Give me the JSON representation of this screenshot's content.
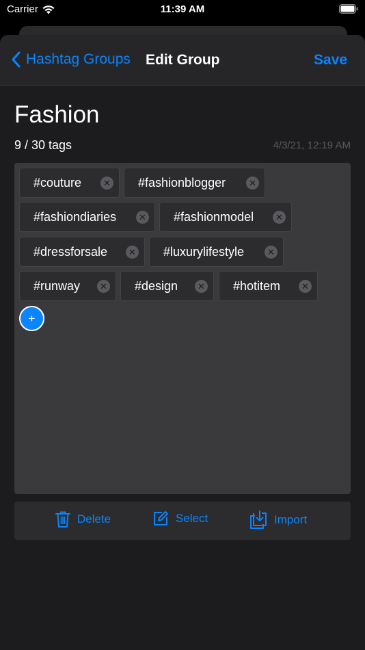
{
  "status": {
    "carrier": "Carrier",
    "time": "11:39 AM"
  },
  "nav": {
    "back_label": "Hashtag Groups",
    "title": "Edit Group",
    "save_label": "Save"
  },
  "group": {
    "name": "Fashion",
    "count_text": "9 / 30 tags",
    "timestamp": "4/3/21, 12:19 AM"
  },
  "tags": [
    "#couture",
    "#fashionblogger",
    "#fashiondiaries",
    "#fashionmodel",
    "#dressforsale",
    "#luxurylifestyle",
    "#runway",
    "#design",
    "#hotitem"
  ],
  "add_label": "+",
  "toolbar": {
    "delete_label": "Delete",
    "select_label": "Select",
    "import_label": "Import"
  },
  "colors": {
    "accent": "#0a84ff",
    "sheet_bg": "#1c1c1e",
    "tag_area_bg": "#3a3a3c",
    "chip_bg": "#2c2c2e"
  },
  "icons": {
    "wifi": "wifi-icon",
    "battery": "battery-icon",
    "back": "chevron-left-icon",
    "remove": "close-circle-icon",
    "delete": "trash-icon",
    "select": "edit-square-icon",
    "import": "import-tray-icon"
  }
}
